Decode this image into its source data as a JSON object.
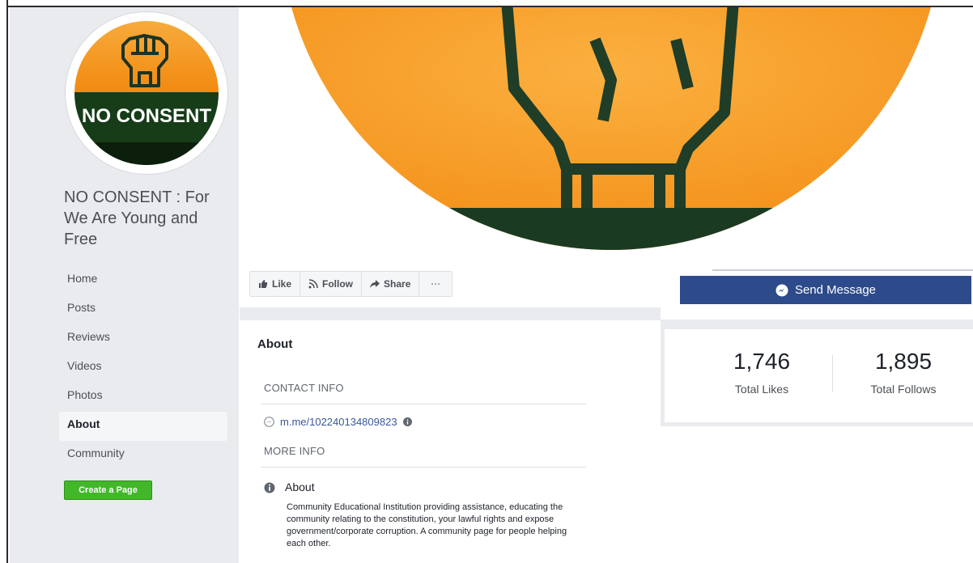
{
  "page": {
    "name": "NO CONSENT : For We Are Young and Free",
    "logo_text": "NO CONSENT"
  },
  "sidebar": {
    "items": [
      {
        "label": "Home"
      },
      {
        "label": "Posts"
      },
      {
        "label": "Reviews"
      },
      {
        "label": "Videos"
      },
      {
        "label": "Photos"
      },
      {
        "label": "About",
        "active": true
      },
      {
        "label": "Community"
      }
    ],
    "create_page": "Create a Page"
  },
  "actions": {
    "like": "Like",
    "follow": "Follow",
    "share": "Share",
    "more": "···"
  },
  "send_message": "Send Message",
  "stats": {
    "likes_value": "1,746",
    "likes_label": "Total Likes",
    "follows_value": "1,895",
    "follows_label": "Total Follows"
  },
  "about": {
    "title": "About",
    "contact_heading": "CONTACT INFO",
    "messenger_link": "m.me/102240134809823",
    "more_heading": "MORE INFO",
    "about_label": "About",
    "description": "Community Educational Institution providing assistance, educating the community relating to the constitution, your lawful rights and expose government/corporate corruption. A community page for people helping each other."
  },
  "colors": {
    "orange": "#f6a12a",
    "dark_green": "#1b3a22",
    "messenger_blue": "#2d4a8a",
    "create_green": "#42b72a",
    "sidebar_bg": "#e9ebee"
  }
}
